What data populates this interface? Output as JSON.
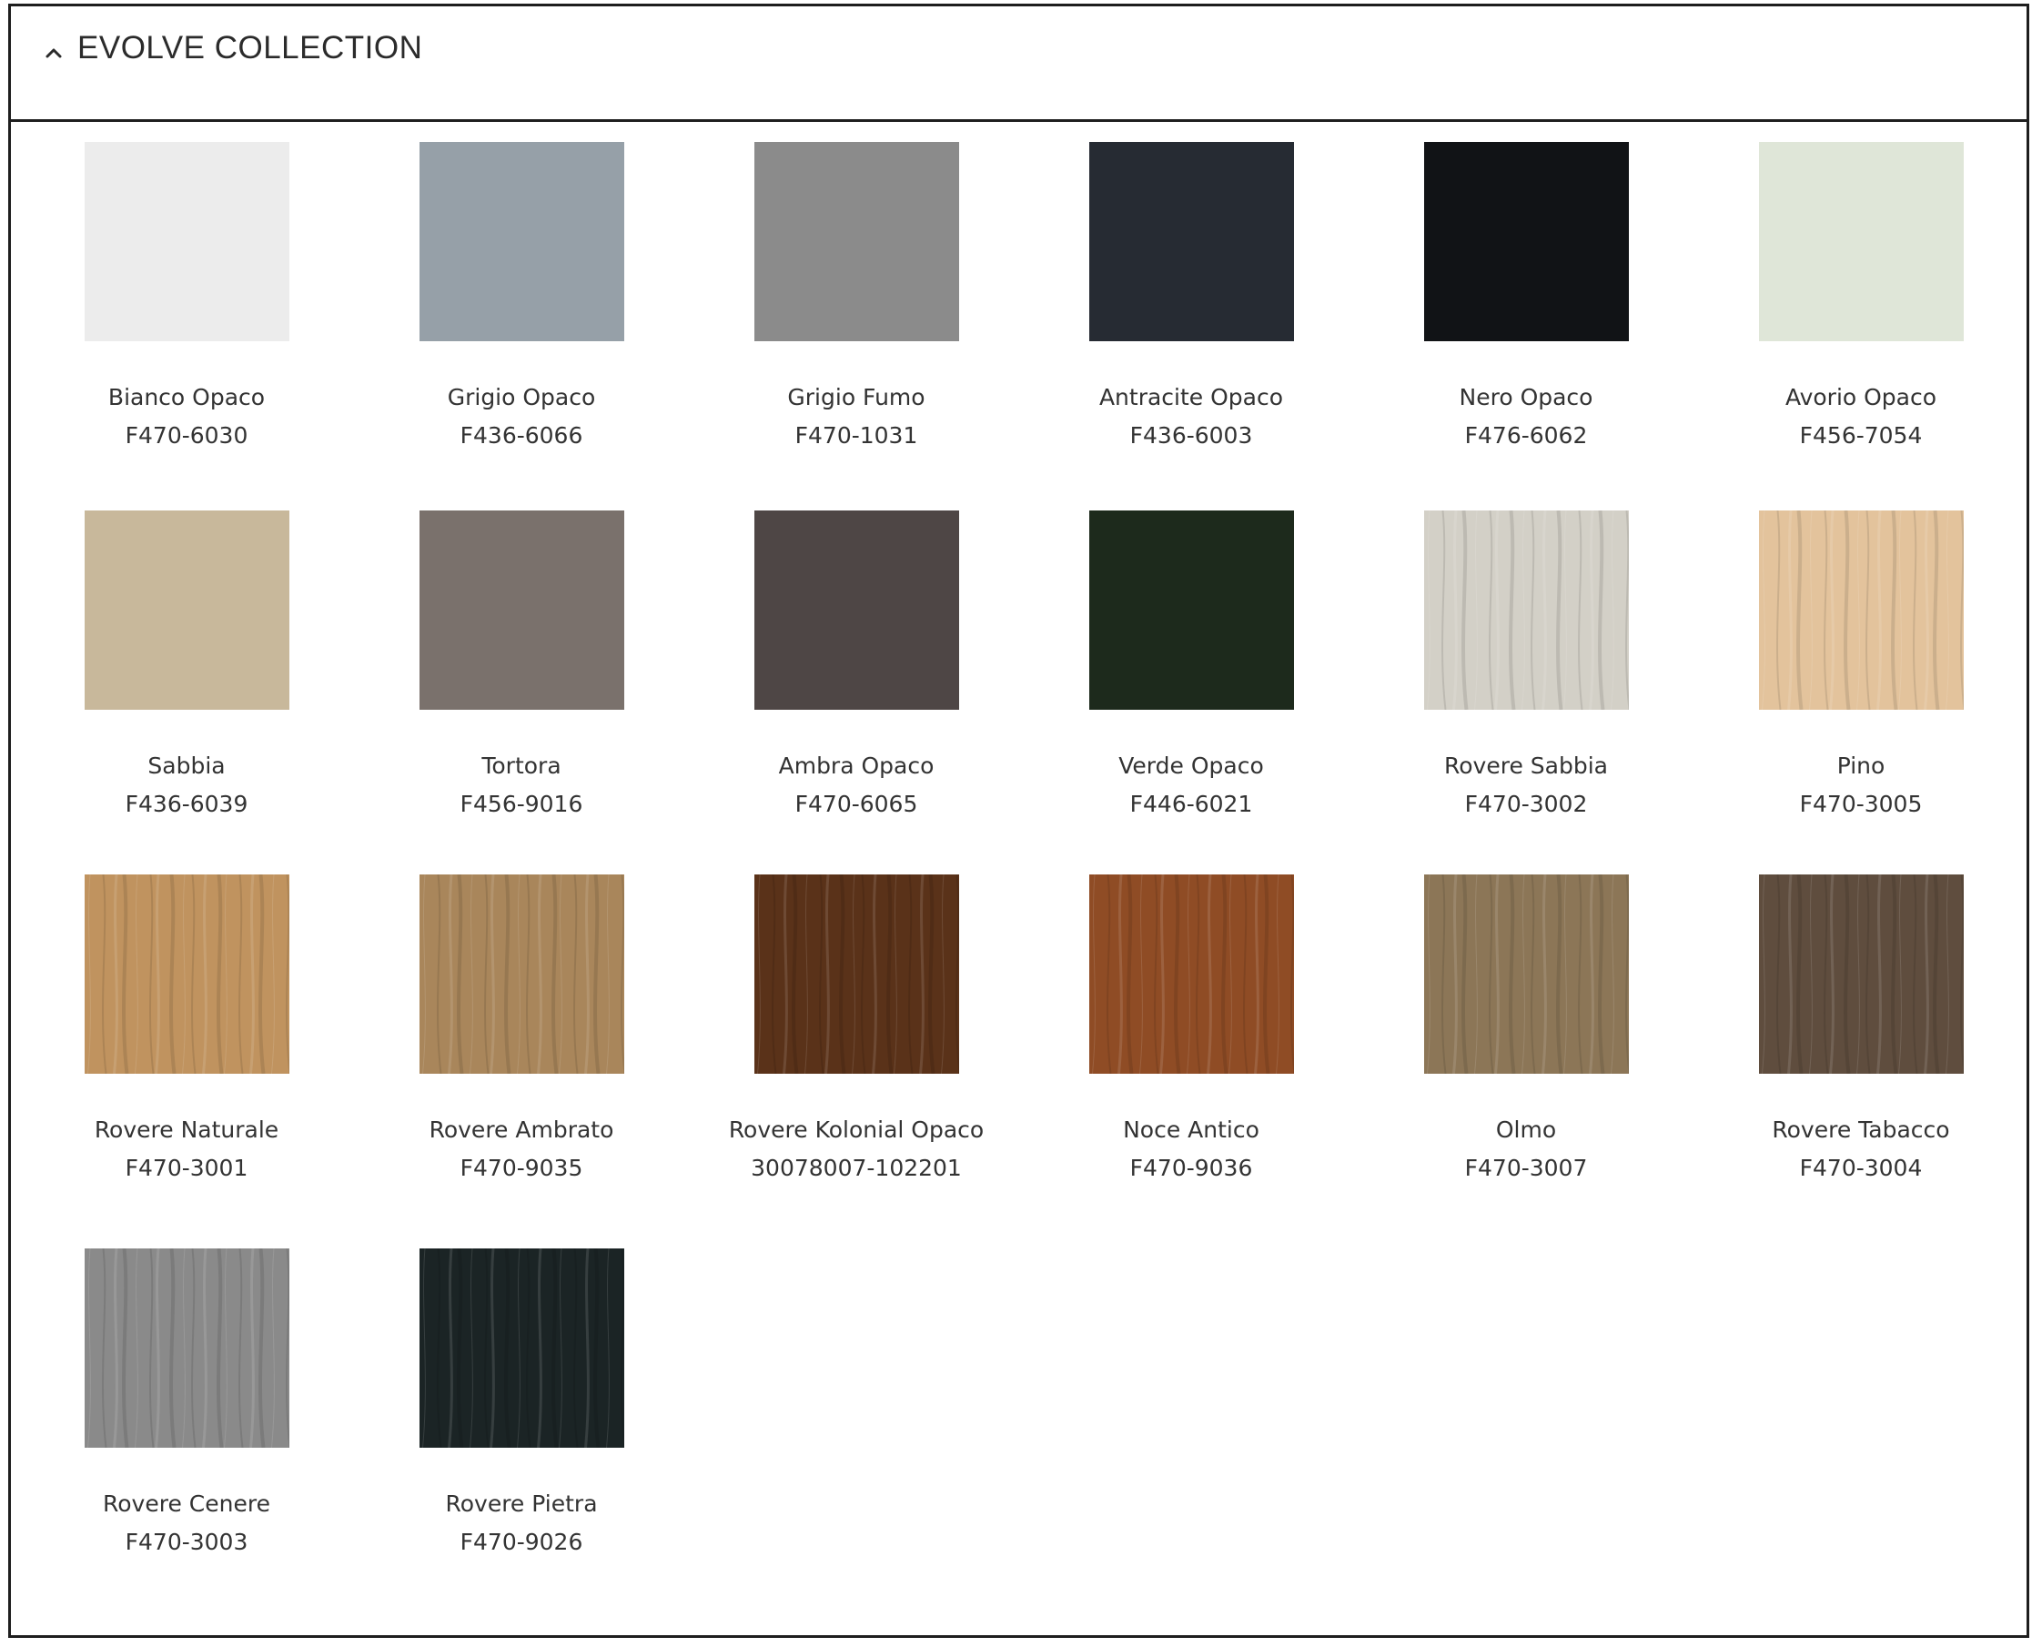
{
  "header": {
    "title": "EVOLVE COLLECTION",
    "icon": "chevron-up-icon"
  },
  "swatches": [
    {
      "name": "Bianco Opaco",
      "code": "F470-6030",
      "color": "#ececec",
      "texture": "plain"
    },
    {
      "name": "Grigio Opaco",
      "code": "F436-6066",
      "color": "#96a0a8",
      "texture": "plain"
    },
    {
      "name": "Grigio Fumo",
      "code": "F470-1031",
      "color": "#8b8b8b",
      "texture": "plain"
    },
    {
      "name": "Antracite Opaco",
      "code": "F436-6003",
      "color": "#262b33",
      "texture": "plain"
    },
    {
      "name": "Nero Opaco",
      "code": "F476-6062",
      "color": "#111316",
      "texture": "plain"
    },
    {
      "name": "Avorio Opaco",
      "code": "F456-7054",
      "color": "#dfe6d8",
      "texture": "plain"
    },
    {
      "name": "Sabbia",
      "code": "F436-6039",
      "color": "#c8b89b",
      "texture": "plain"
    },
    {
      "name": "Tortora",
      "code": "F456-9016",
      "color": "#7a716c",
      "texture": "plain"
    },
    {
      "name": "Ambra Opaco",
      "code": "F470-6065",
      "color": "#4e4645",
      "texture": "plain"
    },
    {
      "name": "Verde Opaco",
      "code": "F446-6021",
      "color": "#1d2a1c",
      "texture": "plain"
    },
    {
      "name": "Rovere Sabbia",
      "code": "F470-3002",
      "color": "#d3d0c7",
      "texture": "wood"
    },
    {
      "name": "Pino",
      "code": "F470-3005",
      "color": "#e3c39c",
      "texture": "wood"
    },
    {
      "name": "Rovere Naturale",
      "code": "F470-3001",
      "color": "#c0935f",
      "texture": "wood"
    },
    {
      "name": "Rovere Ambrato",
      "code": "F470-9035",
      "color": "#a9865b",
      "texture": "wood"
    },
    {
      "name": "Rovere Kolonial Opaco",
      "code": "30078007-102201",
      "color": "#5a3219",
      "texture": "wood"
    },
    {
      "name": "Noce Antico",
      "code": "F470-9036",
      "color": "#8f4c25",
      "texture": "wood"
    },
    {
      "name": "Olmo",
      "code": "F470-3007",
      "color": "#8c7657",
      "texture": "wood"
    },
    {
      "name": "Rovere Tabacco",
      "code": "F470-3004",
      "color": "#5f4d3e",
      "texture": "wood"
    },
    {
      "name": "Rovere Cenere",
      "code": "F470-3003",
      "color": "#8a8a8a",
      "texture": "wood"
    },
    {
      "name": "Rovere Pietra",
      "code": "F470-9026",
      "color": "#1b2425",
      "texture": "wood"
    }
  ]
}
